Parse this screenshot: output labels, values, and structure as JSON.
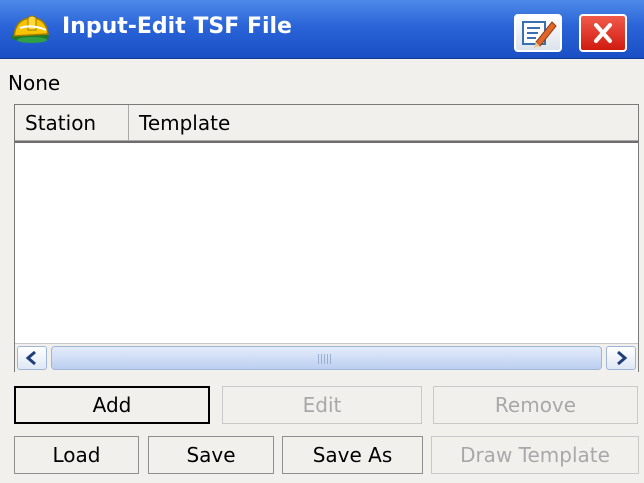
{
  "window": {
    "title": "Input-Edit TSF File",
    "accent": "#2a64d8",
    "icons": {
      "app": "hardhat-icon",
      "notes": "edit-notes-icon",
      "close": "close-icon"
    }
  },
  "file_label": "None",
  "table": {
    "columns": [
      "Station",
      "Template"
    ],
    "rows": []
  },
  "buttons": {
    "add": "Add",
    "edit": "Edit",
    "remove": "Remove",
    "load": "Load",
    "save": "Save",
    "save_as": "Save As",
    "draw_template": "Draw Template"
  },
  "button_states": {
    "edit": "disabled",
    "remove": "disabled",
    "draw_template": "disabled"
  }
}
